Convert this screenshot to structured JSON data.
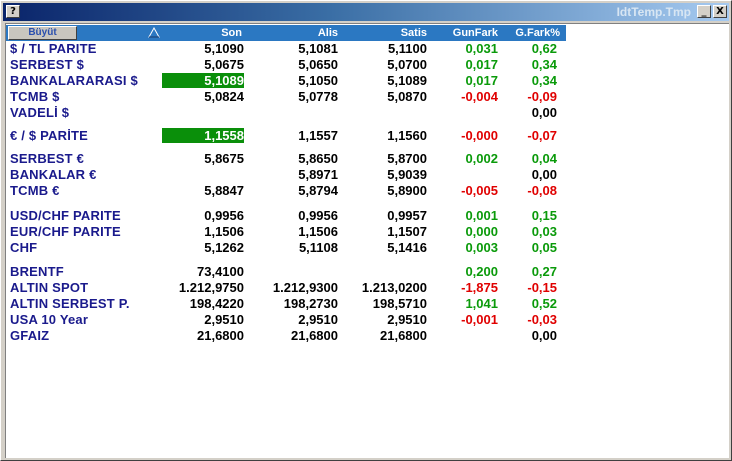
{
  "window": {
    "title": "IdtTemp.Tmp",
    "help_label": "?",
    "minimize_label": "_",
    "close_label": "X"
  },
  "header": {
    "buyut_label": "Büyüt",
    "sort_indicator": "triangle-up-icon",
    "columns": {
      "son": "Son",
      "alis": "Alis",
      "satis": "Satis",
      "gunfark": "GunFark",
      "gfark": "G.Fark%"
    }
  },
  "colors": {
    "header_bg": "#2b78c2",
    "name_text": "#1a1a8c",
    "positive": "#0a9a0a",
    "negative": "#e00000",
    "highlight": "#0a8f0a"
  },
  "rows": [
    {
      "name": "$ / TL PARITE",
      "son": "5,1090",
      "alis": "5,1081",
      "satis": "5,1100",
      "gunfark": "0,031",
      "gfark": "0,62",
      "dir": "pos",
      "hl": false
    },
    {
      "name": "SERBEST $",
      "son": "5,0675",
      "alis": "5,0650",
      "satis": "5,0700",
      "gunfark": "0,017",
      "gfark": "0,34",
      "dir": "pos",
      "hl": false
    },
    {
      "name": "BANKALARARASI $",
      "son": "5,1089",
      "alis": "5,1050",
      "satis": "5,1089",
      "gunfark": "0,017",
      "gfark": "0,34",
      "dir": "pos",
      "hl": true
    },
    {
      "name": "TCMB $",
      "son": "5,0824",
      "alis": "5,0778",
      "satis": "5,0870",
      "gunfark": "-0,004",
      "gfark": "-0,09",
      "dir": "neg",
      "hl": false
    },
    {
      "name": "VADELİ $",
      "son": "",
      "alis": "",
      "satis": "",
      "gunfark": "",
      "gfark": "0,00",
      "dir": "neu",
      "hl": false
    },
    {
      "name": "€ / $ PARİTE",
      "son": "1,1558",
      "alis": "1,1557",
      "satis": "1,1560",
      "gunfark": "-0,000",
      "gfark": "-0,07",
      "dir": "neg",
      "hl": true
    },
    {
      "name": "SERBEST €",
      "son": "5,8675",
      "alis": "5,8650",
      "satis": "5,8700",
      "gunfark": "0,002",
      "gfark": "0,04",
      "dir": "pos",
      "hl": false
    },
    {
      "name": "BANKALAR €",
      "son": "",
      "alis": "5,8971",
      "satis": "5,9039",
      "gunfark": "",
      "gfark": "0,00",
      "dir": "neu",
      "hl": false
    },
    {
      "name": "TCMB €",
      "son": "5,8847",
      "alis": "5,8794",
      "satis": "5,8900",
      "gunfark": "-0,005",
      "gfark": "-0,08",
      "dir": "neg",
      "hl": false
    },
    {
      "name": "USD/CHF PARITE",
      "son": "0,9956",
      "alis": "0,9956",
      "satis": "0,9957",
      "gunfark": "0,001",
      "gfark": "0,15",
      "dir": "pos",
      "hl": false
    },
    {
      "name": "EUR/CHF PARITE",
      "son": "1,1506",
      "alis": "1,1506",
      "satis": "1,1507",
      "gunfark": "0,000",
      "gfark": "0,03",
      "dir": "pos",
      "hl": false
    },
    {
      "name": "CHF",
      "son": "5,1262",
      "alis": "5,1108",
      "satis": "5,1416",
      "gunfark": "0,003",
      "gfark": "0,05",
      "dir": "pos",
      "hl": false
    },
    {
      "name": "BRENTF",
      "son": "73,4100",
      "alis": "",
      "satis": "",
      "gunfark": "0,200",
      "gfark": "0,27",
      "dir": "pos",
      "hl": false
    },
    {
      "name": "ALTIN SPOT",
      "son": "1.212,9750",
      "alis": "1.212,9300",
      "satis": "1.213,0200",
      "gunfark": "-1,875",
      "gfark": "-0,15",
      "dir": "neg",
      "hl": false
    },
    {
      "name": "ALTIN SERBEST P.",
      "son": "198,4220",
      "alis": "198,2730",
      "satis": "198,5710",
      "gunfark": "1,041",
      "gfark": "0,52",
      "dir": "pos",
      "hl": false
    },
    {
      "name": "USA 10 Year",
      "son": "2,9510",
      "alis": "2,9510",
      "satis": "2,9510",
      "gunfark": "-0,001",
      "gfark": "-0,03",
      "dir": "neg",
      "hl": false
    },
    {
      "name": "GFAIZ",
      "son": "21,6800",
      "alis": "21,6800",
      "satis": "21,6800",
      "gunfark": "",
      "gfark": "0,00",
      "dir": "neu",
      "hl": false
    }
  ]
}
